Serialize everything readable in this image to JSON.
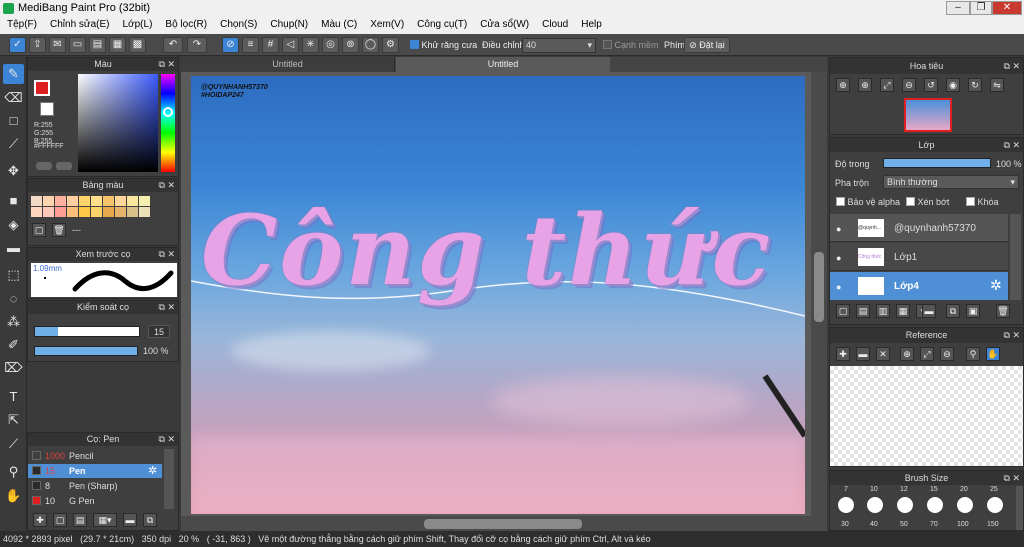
{
  "window": {
    "title": "MediBang Paint Pro (32bit)"
  },
  "menu": [
    "Tệp(F)",
    "Chỉnh sửa(E)",
    "Lớp(L)",
    "Bộ lọc(R)",
    "Chọn(S)",
    "Chụp(N)",
    "Màu (C)",
    "Xem(V)",
    "Công cụ(T)",
    "Cửa sổ(W)",
    "Cloud",
    "Help"
  ],
  "toolbar": {
    "antialias_label": "Khử răng cưa",
    "correction_label": "Điều chỉnh",
    "correction_value": "40",
    "snap_label": "Cạnh mềm",
    "brush_label": "Phím",
    "reset_label": "Đặt lại"
  },
  "tabs": [
    "Untitled",
    "Untitled"
  ],
  "color_panel": {
    "title": "Màu",
    "r": "R:255",
    "g": "G:255",
    "b": "B:255",
    "hex": "#FFFFFF",
    "primary_color": "#e02020",
    "secondary_color": "#ffffff"
  },
  "palette_panel": {
    "title": "Bảng màu",
    "dash": "---",
    "swatches": [
      "#f4d9c6",
      "#ffd3b0",
      "#ffb0a0",
      "#ffcf9f",
      "#ffd56b",
      "#ffe08a",
      "#f7c36a",
      "#ffd69a",
      "#fbe6a0",
      "#f6f0b0",
      "#ffd7c0",
      "#ffc8b8",
      "#ff9e95",
      "#ffbf7a",
      "#ffc746",
      "#ffd26a",
      "#e8a84c",
      "#e6b46a",
      "#d8c08a",
      "#ece0b8"
    ]
  },
  "preview_panel": {
    "title": "Xem trước cọ",
    "size": "1.09mm"
  },
  "brush_control": {
    "title": "Kiểm soát cọ",
    "size": "15",
    "opacity": "100 %",
    "size_fraction": 0.22,
    "opacity_fraction": 1.0
  },
  "brush_list": {
    "title": "Cọ: Pen",
    "items": [
      {
        "size": "1000",
        "name": "Pencil",
        "color": "#2a2a2a",
        "selected": false
      },
      {
        "size": "15",
        "name": "Pen",
        "color": "#2a2a2a",
        "selected": true
      },
      {
        "size": "8",
        "name": "Pen (Sharp)",
        "color": "#2a2a2a",
        "selected": false
      },
      {
        "size": "10",
        "name": "G Pen",
        "color": "#e02020",
        "selected": false
      }
    ]
  },
  "navigator": {
    "title": "Hoa tiêu"
  },
  "layer_panel": {
    "title": "Lớp",
    "opacity_label": "Độ trong",
    "opacity_value": "100 %",
    "opacity_fraction": 1.0,
    "blend_label": "Pha trộn",
    "blend_value": "Bình thường",
    "protect_alpha": "Bảo vệ alpha",
    "clipping": "Xén bớt",
    "lock": "Khóa",
    "layers": [
      {
        "name": "@quynhanh57370",
        "thumb": "@quynh...",
        "selected": false
      },
      {
        "name": "Lớp1",
        "thumb": "Công thức",
        "selected": false
      },
      {
        "name": "Lớp4",
        "thumb": "",
        "selected": true
      }
    ]
  },
  "reference": {
    "title": "Reference"
  },
  "brush_size": {
    "title": "Brush Size",
    "top": [
      "7",
      "10",
      "12",
      "15",
      "20",
      "25"
    ],
    "bottom": [
      "30",
      "40",
      "50",
      "70",
      "100",
      "150"
    ]
  },
  "artwork": {
    "watermark_1": "@QUYNHANH57370",
    "watermark_2": "#HOIDAP247",
    "headline": "Công thức"
  },
  "status": {
    "size": "4092 * 2893 pixel",
    "physical": "(29.7 * 21cm)",
    "dpi": "350 dpi",
    "zoom": "20 %",
    "coords": "( -31, 863 )",
    "hint": "Vẽ một đường thẳng bằng cách giữ phím Shift, Thay đổi cỡ cọ bằng cách giữ phím Ctrl, Alt và kéo"
  }
}
